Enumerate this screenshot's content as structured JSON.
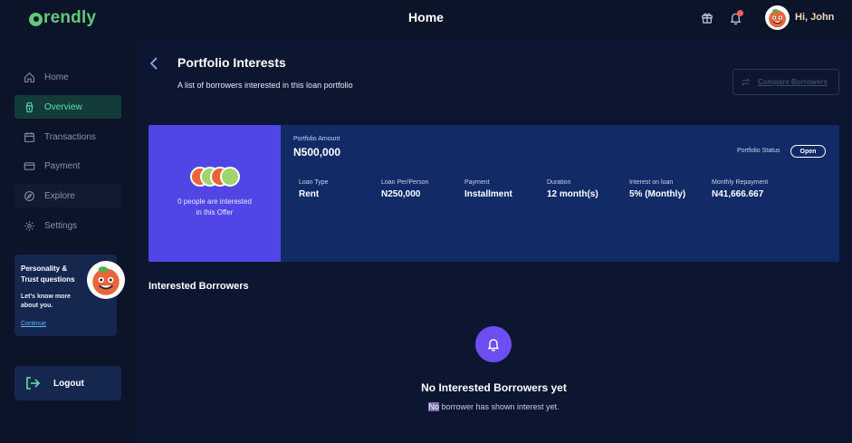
{
  "topbar": {
    "logo_text": "rendly",
    "page_heading": "Home",
    "greeting": "Hi, John"
  },
  "sidebar": {
    "items": [
      {
        "label": "Home",
        "icon": "home-icon"
      },
      {
        "label": "Overview",
        "icon": "overview-icon",
        "active": true
      },
      {
        "label": "Transactions",
        "icon": "calendar-icon"
      },
      {
        "label": "Payment",
        "icon": "card-icon"
      },
      {
        "label": "Explore",
        "icon": "compass-icon"
      },
      {
        "label": "Settings",
        "icon": "gear-icon"
      }
    ],
    "promo": {
      "title": "Personality & Trust questions",
      "subtitle": "Let's know more about you.",
      "link": "Continue"
    },
    "logout_label": "Logout"
  },
  "main": {
    "title": "Portfolio Interests",
    "subtitle": "A list of borrowers interested in this loan portfolio",
    "compare_label": "Compare Borrowers",
    "summary": {
      "interest_text": "0 people are interested in this Offer",
      "amount_label": "Portfolio Amount",
      "amount_value": "N500,000",
      "status_label": "Portfolio Status",
      "status_value": "Open",
      "details": [
        {
          "label": "Loan Type",
          "value": "Rent"
        },
        {
          "label": "Loan Per/Person",
          "value": "N250,000"
        },
        {
          "label": "Payment",
          "value": "Installment"
        },
        {
          "label": "Duration",
          "value": "12 month(s)"
        },
        {
          "label": "Interest on loan",
          "value": "5% (Monthly)"
        },
        {
          "label": "Monthly Repayment",
          "value": "N41,666.667"
        }
      ]
    },
    "section_title": "Interested Borrowers",
    "empty": {
      "title": "No Interested Borrowers yet",
      "sub_highlight": "No",
      "sub_rest": " borrower has shown interest yet."
    }
  },
  "colors": {
    "background": "#0b1428",
    "accent_green": "#63c87a",
    "active_nav": "#5ee0b0",
    "card_purple": "#4f46e5",
    "card_blue": "#122a66"
  }
}
